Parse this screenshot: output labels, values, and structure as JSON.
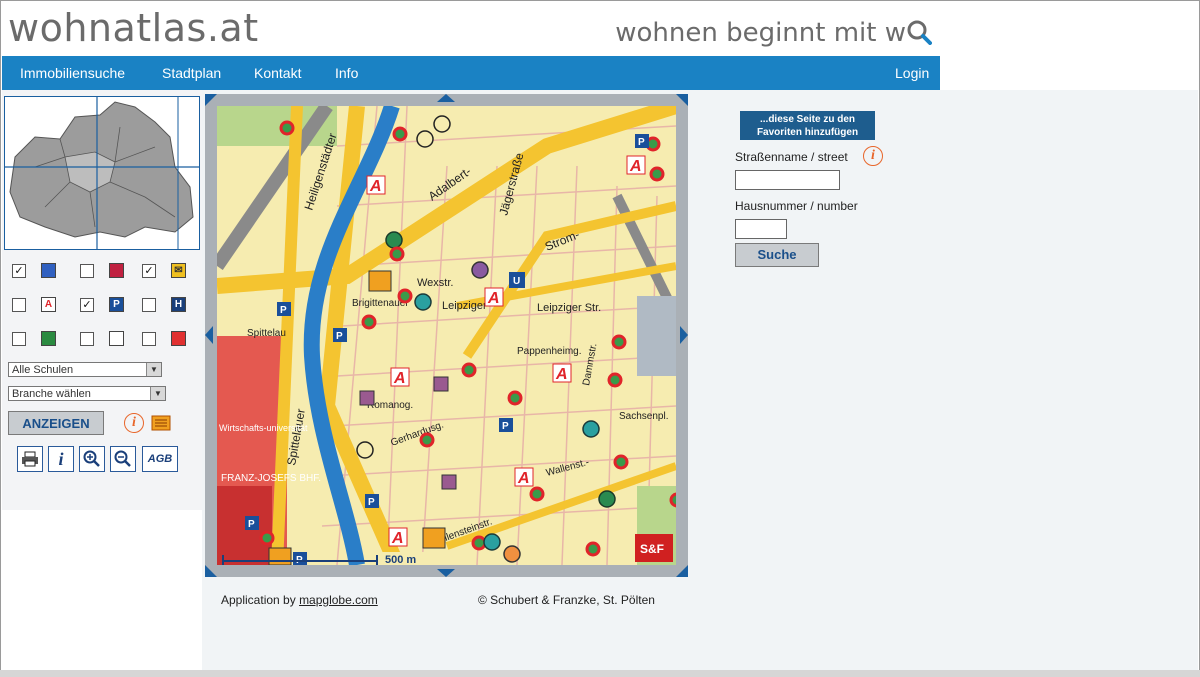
{
  "header": {
    "logo": "wohnatlas.at",
    "slogan": "wohnen beginnt mit w"
  },
  "nav": {
    "items": [
      "Immobiliensuche",
      "Stadtplan",
      "Kontakt",
      "Info"
    ],
    "login": "Login"
  },
  "sidebar": {
    "layers": [
      {
        "checked": true,
        "icon": "train-icon"
      },
      {
        "checked": false,
        "icon": "theatre-icon"
      },
      {
        "checked": true,
        "icon": "post-icon"
      },
      {
        "checked": false,
        "icon": "pharmacy-icon"
      },
      {
        "checked": true,
        "icon": "parking-icon"
      },
      {
        "checked": false,
        "icon": "hotel-icon"
      },
      {
        "checked": false,
        "icon": "park-icon"
      },
      {
        "checked": false,
        "icon": "shop-icon"
      },
      {
        "checked": false,
        "icon": "category-icon"
      }
    ],
    "school_select": "Alle Schulen",
    "branch_select": "Branche wählen",
    "show_button": "ANZEIGEN",
    "tools": [
      "print-icon",
      "info-icon",
      "zoom-in-icon",
      "zoom-out-icon",
      "agb-icon"
    ],
    "agb_label": "AGB"
  },
  "map": {
    "scale_label": "500 m",
    "publisher_logo": "S&F",
    "street_labels": [
      "Heiligenstädter",
      "Adalbert-",
      "Jägerstraße",
      "Strom-",
      "Wexstr.",
      "Leipziger",
      "Leipziger Str.",
      "Spittelau",
      "Pappenheimg.",
      "Brigittenauer",
      "Spittelauer",
      "Wallensteinstr.",
      "Wallenst.-",
      "FRANZ-JOSEFS BHF.",
      "Wirtschafts-universität",
      "Sachsenpl.",
      "Dammstr.",
      "Romanog.",
      "Gerhardusg."
    ]
  },
  "credits": {
    "prefix": "Application by",
    "link": "mapglobe.com",
    "copyright": "© Schubert & Franzke, St. Pölten"
  },
  "search_panel": {
    "favorites": "...diese Seite zu den Favoriten hinzufügen",
    "street_label": "Straßenname / street",
    "number_label": "Hausnummer / number",
    "street_value": "",
    "number_value": "",
    "search_button": "Suche"
  },
  "colors": {
    "nav_blue": "#1a82c4",
    "pharmacy_red": "#e0242a",
    "accent_orange": "#e8662a"
  }
}
